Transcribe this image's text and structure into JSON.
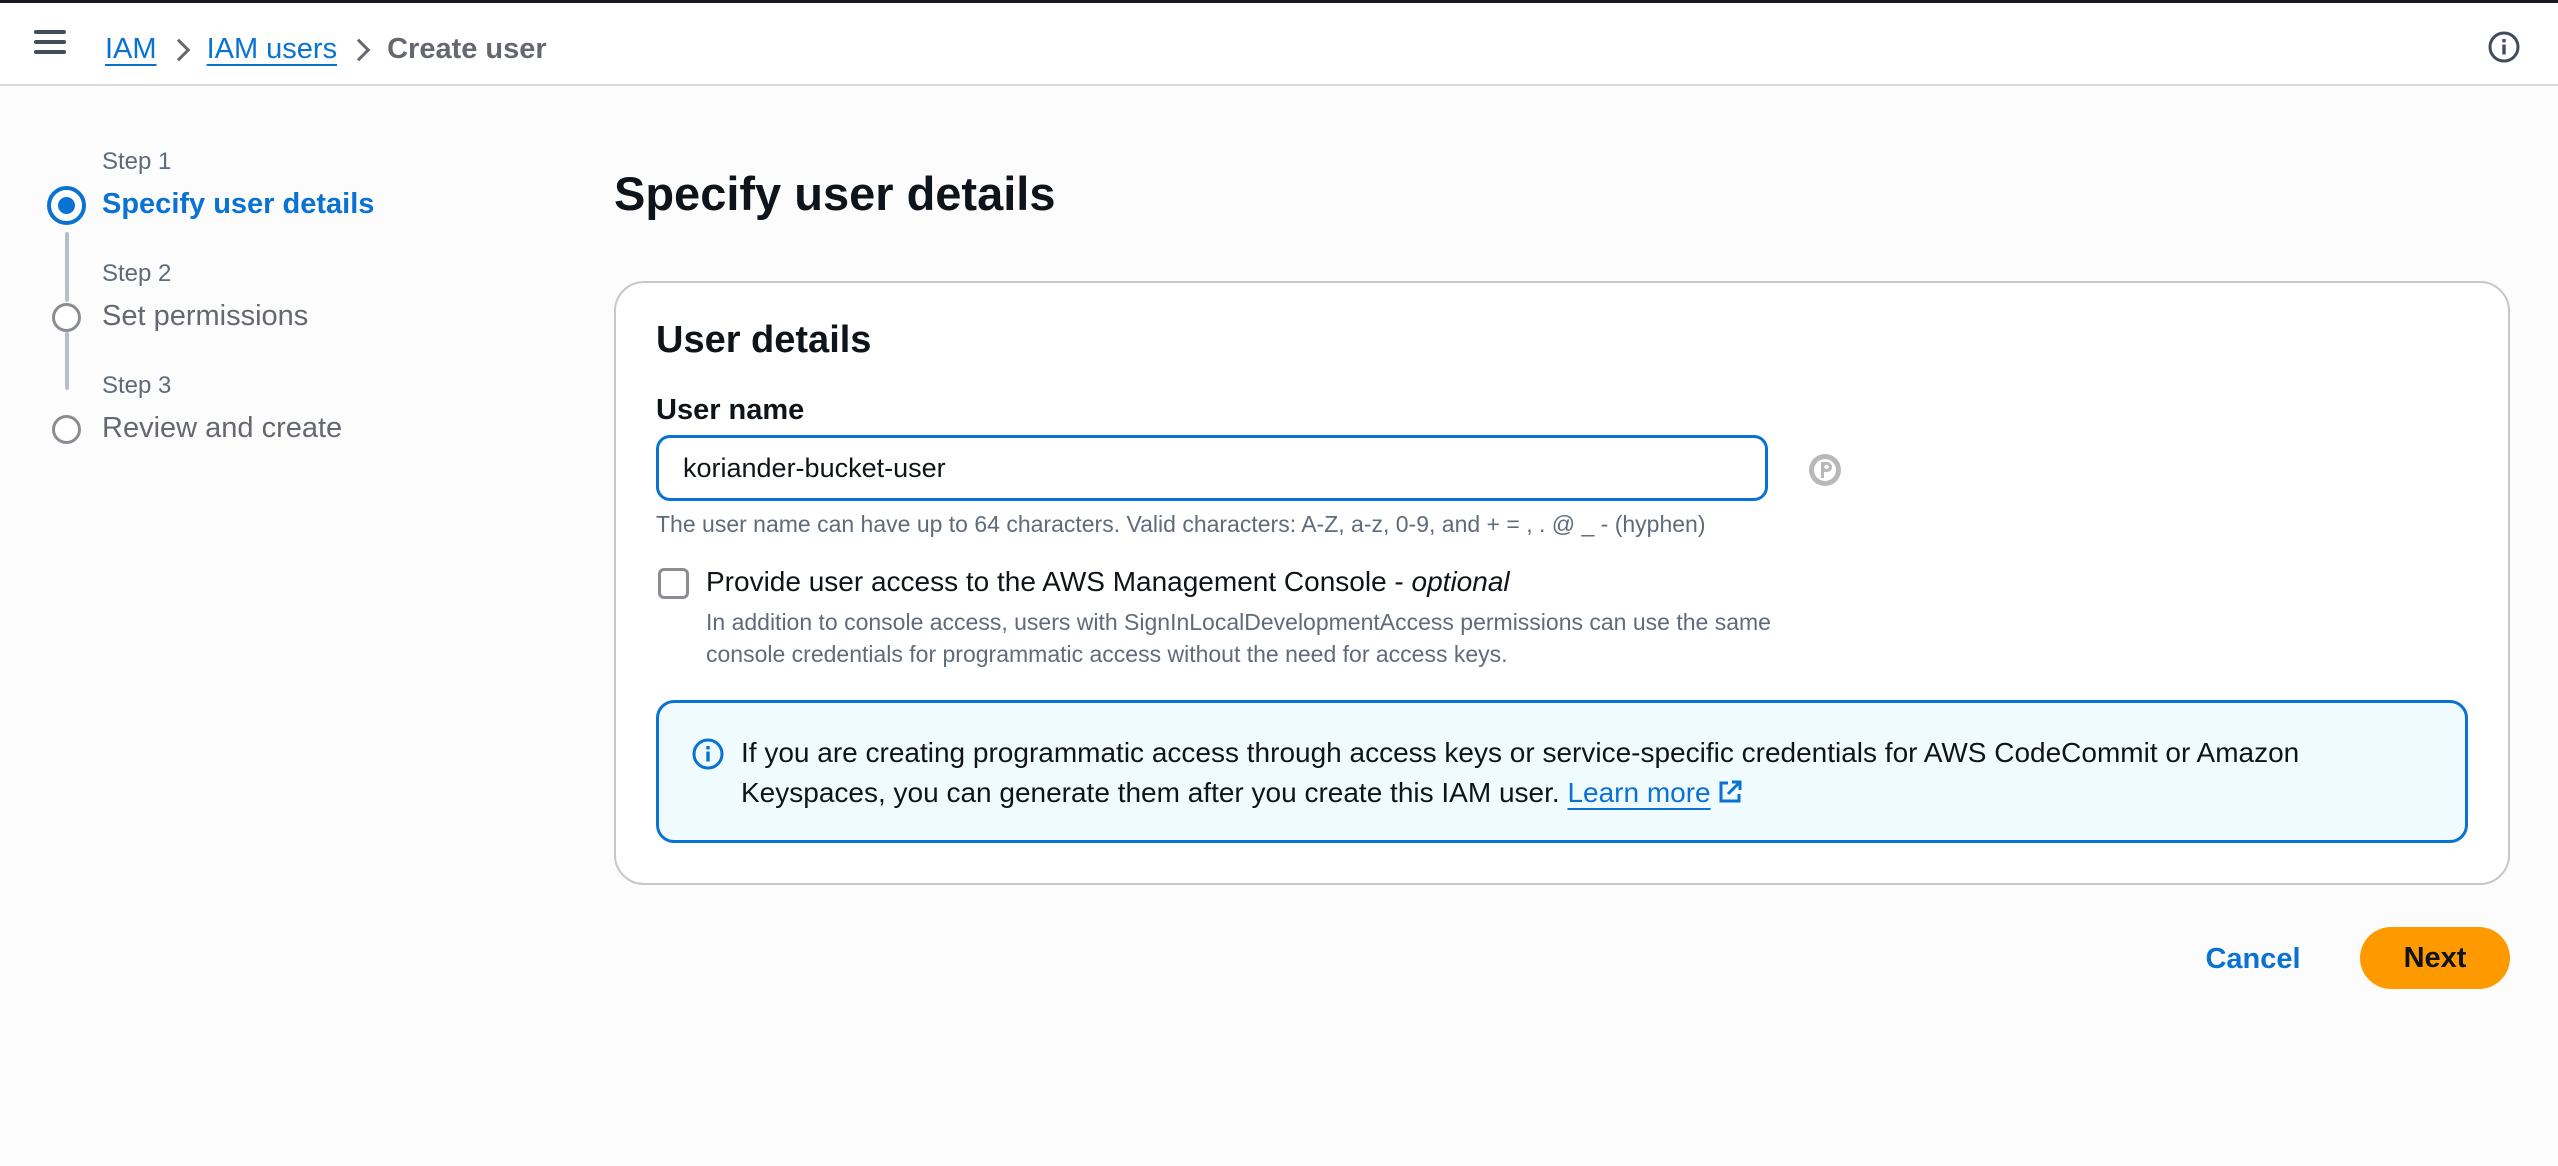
{
  "topbar": {
    "breadcrumb": [
      {
        "label": "IAM",
        "link": true
      },
      {
        "label": "IAM users",
        "link": true
      },
      {
        "label": "Create user",
        "link": false
      }
    ],
    "menu_icon": "hamburger-menu-icon",
    "info_icon": "info-circle-icon"
  },
  "wizard": {
    "steps": [
      {
        "number": "Step 1",
        "title": "Specify user details",
        "active": true
      },
      {
        "number": "Step 2",
        "title": "Set permissions",
        "active": false
      },
      {
        "number": "Step 3",
        "title": "Review and create",
        "active": false
      }
    ]
  },
  "main": {
    "title": "Specify user details",
    "card": {
      "title": "User details",
      "username_label": "User name",
      "username_value": "koriander-bucket-user",
      "username_constraint": "The user name can have up to 64 characters. Valid characters: A-Z, a-z, 0-9, and + = , . @ _ - (hyphen)",
      "console_access_label": "Provide user access to the AWS Management Console - ",
      "console_access_optional": "optional",
      "console_access_checked": false,
      "console_access_description": "In addition to console access, users with SignInLocalDevelopmentAccess permissions can use the same console credentials for programmatic access without the need for access keys.",
      "alert_text": "If you are creating programmatic access through access keys or service-specific credentials for AWS CodeCommit or Amazon Keyspaces, you can generate them after you create this IAM user. ",
      "alert_link": "Learn more"
    }
  },
  "actions": {
    "cancel_label": "Cancel",
    "next_label": "Next"
  },
  "colors": {
    "link": "#0972d3",
    "primary_button": "#ff9900",
    "alert_background": "#f0fbff",
    "secondary_text": "#5f6b7a"
  }
}
